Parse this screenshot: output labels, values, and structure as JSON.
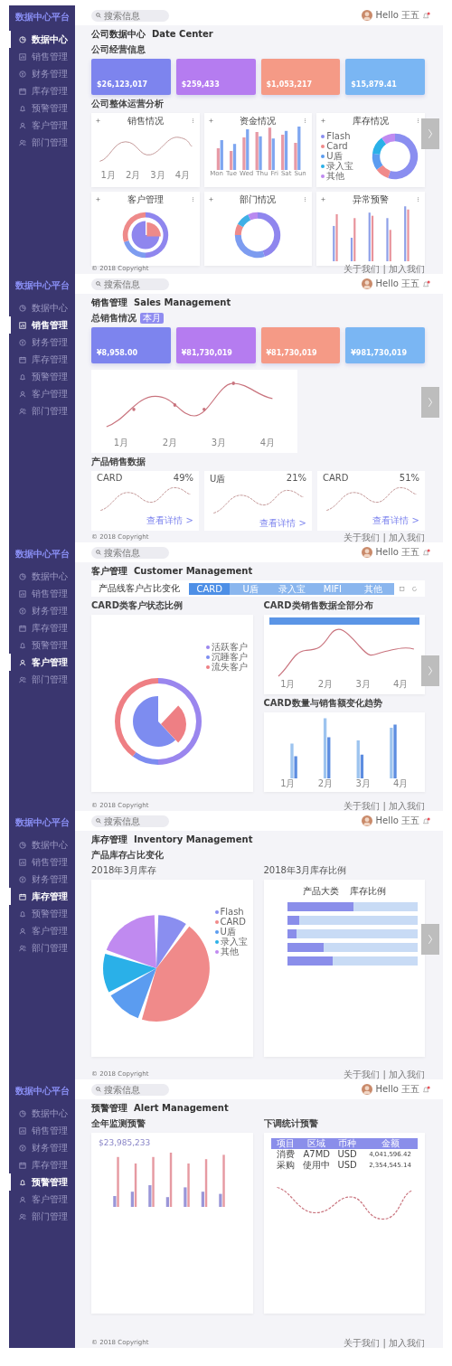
{
  "screens": [
    {
      "kind": "data_center",
      "brand": "数据中心平台",
      "search": {
        "placeholder": "搜索信息"
      },
      "user": "Hello 王五",
      "next_button": true,
      "nav": [
        {
          "label": "数据中心",
          "selected": true
        },
        {
          "label": "销售管理",
          "selected": false
        },
        {
          "label": "财务管理",
          "selected": false
        },
        {
          "label": "库存管理",
          "selected": false
        },
        {
          "label": "预警管理",
          "selected": false
        },
        {
          "label": "客户管理",
          "selected": false
        },
        {
          "label": "部门管理",
          "selected": false
        }
      ],
      "title": "公司数据中心",
      "title_en": "Date Center",
      "section_1": "公司经营信息",
      "cards": [
        {
          "value": "$26,123,017",
          "color": "#7d84ee"
        },
        {
          "value": "$259,433",
          "color": "#b57cf0"
        },
        {
          "value": "$1,053,217",
          "color": "#f59a86"
        },
        {
          "value": "$15,879.41",
          "color": "#7ab6f3"
        }
      ],
      "section_2": "公司整体运营分析",
      "panels": [
        {
          "kind": "line",
          "title": "销售情况",
          "x_labels": [
            "1月",
            "2月",
            "3月",
            "4月"
          ]
        },
        {
          "kind": "bar",
          "title": "资金情况",
          "x_labels": [
            "Mon",
            "Tue",
            "Wed",
            "Thu",
            "Fri",
            "Sat",
            "Sun"
          ]
        },
        {
          "kind": "donut",
          "title": "库存情况",
          "legend": [
            {
              "label": "Flash",
              "color": "#8a8ef0"
            },
            {
              "label": "Card",
              "color": "#f08a8a"
            },
            {
              "label": "U盾",
              "color": "#5b9cf0"
            },
            {
              "label": "录入宝",
              "color": "#2ab0e8"
            },
            {
              "label": "其他",
              "color": "#c08af0"
            }
          ]
        },
        {
          "kind": "pie_ring",
          "title": "客户管理"
        },
        {
          "kind": "ring",
          "title": "部门情况"
        },
        {
          "kind": "thin_bars",
          "title": "异常预警"
        }
      ],
      "footer": "© 2018 Copyright",
      "footer_links": "关于我们 | 加入我们"
    },
    {
      "kind": "sales",
      "brand": "数据中心平台",
      "search": {
        "placeholder": "搜索信息"
      },
      "user": "Hello 王五",
      "next_button": true,
      "nav": [
        {
          "label": "数据中心",
          "selected": false
        },
        {
          "label": "销售管理",
          "selected": true
        },
        {
          "label": "财务管理",
          "selected": false
        },
        {
          "label": "库存管理",
          "selected": false
        },
        {
          "label": "预警管理",
          "selected": false
        },
        {
          "label": "客户管理",
          "selected": false
        },
        {
          "label": "部门管理",
          "selected": false
        }
      ],
      "title": "销售管理",
      "title_en": "Sales Management",
      "section_1": "总销售情况",
      "badge": "本月",
      "cards": [
        {
          "value": "¥8,958.00",
          "color": "#7d84ee"
        },
        {
          "value": "¥81,730,019",
          "color": "#b57cf0"
        },
        {
          "value": "¥81,730,019",
          "color": "#f59a86"
        },
        {
          "value": "¥981,730,019",
          "color": "#7ab6f3"
        }
      ],
      "x_labels": [
        "1月",
        "2月",
        "3月",
        "4月"
      ],
      "section_2": "产品销售数据",
      "products": [
        {
          "name": "CARD",
          "percent": "49%",
          "link": "查看详情 >"
        },
        {
          "name": "U盾",
          "percent": "21%",
          "link": "查看详情 >"
        },
        {
          "name": "CARD",
          "percent": "51%",
          "link": "查看详情 >"
        }
      ],
      "footer": "© 2018 Copyright",
      "footer_links": "关于我们 | 加入我们"
    },
    {
      "kind": "customers",
      "brand": "数据中心平台",
      "search": {
        "placeholder": "搜索信息"
      },
      "user": "Hello 王五",
      "next_button": true,
      "nav": [
        {
          "label": "数据中心",
          "selected": false
        },
        {
          "label": "销售管理",
          "selected": false
        },
        {
          "label": "财务管理",
          "selected": false
        },
        {
          "label": "库存管理",
          "selected": false
        },
        {
          "label": "预警管理",
          "selected": false
        },
        {
          "label": "客户管理",
          "selected": true
        },
        {
          "label": "部门管理",
          "selected": false
        }
      ],
      "title": "客户管理",
      "title_en": "Customer Management",
      "tab_label": "产品线客户占比变化",
      "tabs": [
        {
          "label": "CARD",
          "selected": true
        },
        {
          "label": "U盾",
          "selected": false
        },
        {
          "label": "录入宝",
          "selected": false
        },
        {
          "label": "MIFI",
          "selected": false
        },
        {
          "label": "其他",
          "selected": false
        }
      ],
      "left_title": "CARD类客户状态比例",
      "legend": [
        {
          "label": "活跃客户",
          "color": "#9a86ee"
        },
        {
          "label": "沉睡客户",
          "color": "#7d8cf0"
        },
        {
          "label": "流失客户",
          "color": "#ee7f84"
        }
      ],
      "right_title_1": "CARD类销售数据全部分布",
      "right_title_2": "CARD数量与销售额变化趋势",
      "x_labels_1": [
        "1月",
        "2月",
        "3月",
        "4月"
      ],
      "x_labels_2": [
        "1月",
        "2月",
        "3月",
        "4月"
      ],
      "footer": "© 2018 Copyright",
      "footer_links": "关于我们 | 加入我们"
    },
    {
      "kind": "inventory",
      "brand": "数据中心平台",
      "search": {
        "placeholder": "搜索信息"
      },
      "user": "Hello 王五",
      "next_button": true,
      "nav": [
        {
          "label": "数据中心",
          "selected": false
        },
        {
          "label": "销售管理",
          "selected": false
        },
        {
          "label": "财务管理",
          "selected": false
        },
        {
          "label": "库存管理",
          "selected": true
        },
        {
          "label": "预警管理",
          "selected": false
        },
        {
          "label": "客户管理",
          "selected": false
        },
        {
          "label": "部门管理",
          "selected": false
        }
      ],
      "title": "库存管理",
      "title_en": "Inventory Management",
      "section_1": "产品库存占比变化",
      "left_title": "2018年3月库存",
      "right_title": "2018年3月库存比例",
      "legend": [
        {
          "label": "Flash",
          "color": "#8a8ef0"
        },
        {
          "label": "CARD",
          "color": "#f08a8a"
        },
        {
          "label": "U盾",
          "color": "#5b9cf0"
        },
        {
          "label": "录入宝",
          "color": "#2ab0e8"
        },
        {
          "label": "其他",
          "color": "#c08af0"
        }
      ],
      "columns": [
        "产品大类",
        "库存比例"
      ],
      "bars": [
        {
          "level": 0.51
        },
        {
          "level": 0.09
        },
        {
          "level": 0.07
        },
        {
          "level": 0.28
        },
        {
          "level": 0.35
        }
      ],
      "footer": "© 2018 Copyright",
      "footer_links": "关于我们 | 加入我们"
    },
    {
      "kind": "alerts",
      "brand": "数据中心平台",
      "search": {
        "placeholder": "搜索信息"
      },
      "user": "Hello 王五",
      "next_button": false,
      "nav": [
        {
          "label": "数据中心",
          "selected": false
        },
        {
          "label": "销售管理",
          "selected": false
        },
        {
          "label": "财务管理",
          "selected": false
        },
        {
          "label": "库存管理",
          "selected": false
        },
        {
          "label": "预警管理",
          "selected": true
        },
        {
          "label": "客户管理",
          "selected": false
        },
        {
          "label": "部门管理",
          "selected": false
        }
      ],
      "title": "预警管理",
      "title_en": "Alert Management",
      "left_title": "全年监测预警",
      "total": "$23,985,233",
      "right_title": "下调统计预警",
      "table": {
        "columns": [
          "项目",
          "区域",
          "币种",
          "金额"
        ],
        "rows": [
          [
            "消费",
            "A7MD",
            "USD",
            "4,041,596.42"
          ],
          [
            "采购",
            "使用中",
            "USD",
            "2,354,545.14"
          ]
        ]
      },
      "footer": "© 2018 Copyright",
      "footer_links": "关于我们 | 加入我们"
    }
  ]
}
